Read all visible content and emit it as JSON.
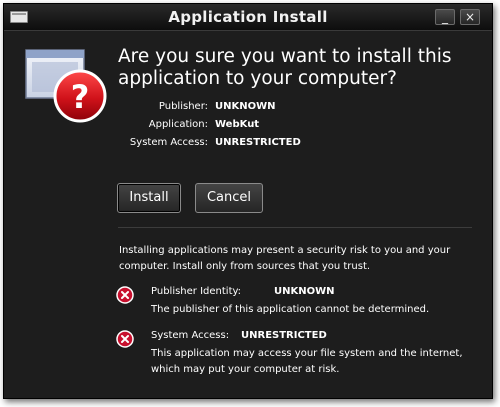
{
  "window": {
    "title": "Application Install",
    "minimize_label": "_",
    "close_label": "×"
  },
  "dialog": {
    "heading": "Are you sure you want to install this application to your computer?",
    "info": [
      {
        "label": "Publisher:",
        "value": "UNKNOWN"
      },
      {
        "label": "Application:",
        "value": "WebKut"
      },
      {
        "label": "System Access:",
        "value": "UNRESTRICTED"
      }
    ],
    "install_label": "Install",
    "cancel_label": "Cancel",
    "warning": "Installing applications may present a security risk to you and your computer. Install only from sources that you trust.",
    "details": [
      {
        "label": "Publisher Identity:",
        "value": "UNKNOWN",
        "description": "The publisher of this application cannot be determined."
      },
      {
        "label": "System Access:",
        "value": "UNRESTRICTED",
        "description": "This application may access your file system and the internet, which may put your computer at risk."
      }
    ]
  },
  "icons": {
    "app": "question-window-icon",
    "detail_1": "error-x-icon",
    "detail_2": "error-x-icon"
  },
  "colors": {
    "background": "#1d1d1d",
    "text": "#ffffff",
    "error_red": "#c8102e"
  }
}
